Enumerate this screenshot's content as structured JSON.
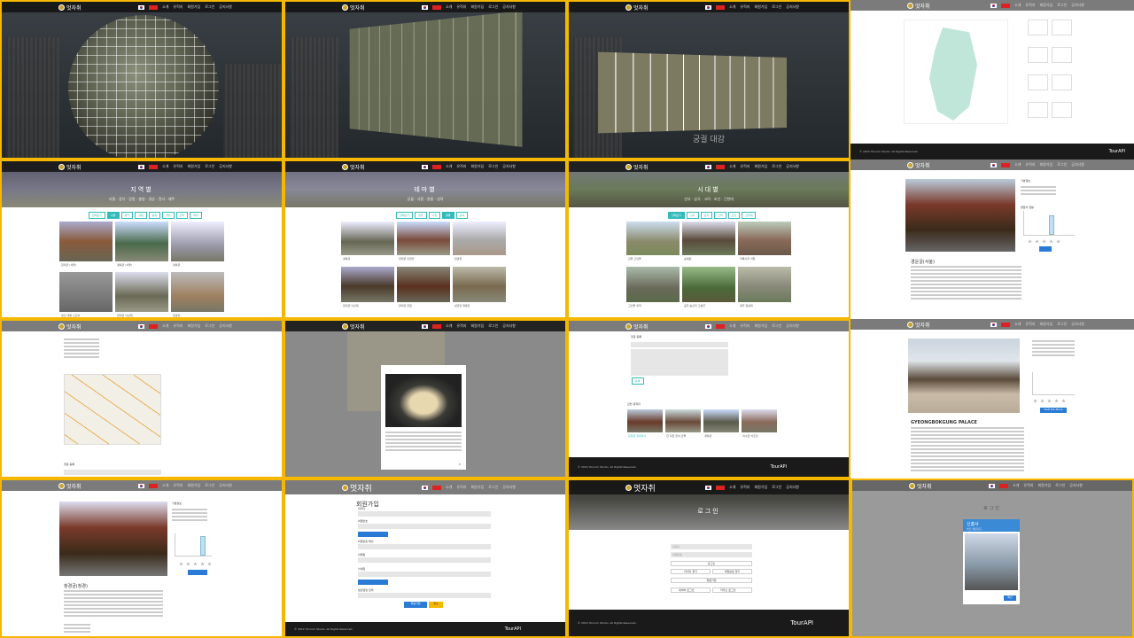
{
  "site": {
    "logo_text": "멋자취",
    "nav_items": [
      "소개",
      "유적지",
      "회원가입",
      "로그인",
      "공지사항"
    ],
    "footer_copy": "© 2019 Ybroom Studio. All Rights Reserved.",
    "footer_brand": "TourAPI",
    "footer_brand_sup": "3.0"
  },
  "panels": {
    "region_title": "지역별",
    "region_sub": "서울 · 경기 · 강원 · 충청 · 경상 · 전라 · 제주",
    "theme_title": "테마별",
    "theme_sub": "궁궐 · 사찰 · 왕릉 · 성곽",
    "era_title": "시대별",
    "era_sub": "선사 · 삼국 · 고려 · 조선 · 근현대",
    "region_tabs": [
      "전체보기",
      "서울",
      "경기",
      "강원",
      "충청",
      "경상",
      "전라",
      "제주"
    ],
    "theme_tabs": [
      "전체보기",
      "궁궐",
      "사찰",
      "왕릉",
      "성곽"
    ],
    "era_tabs": [
      "전체보기",
      "선사",
      "삼국",
      "고려",
      "조선",
      "근현대"
    ],
    "region_captions": [
      "창덕궁 (서울)",
      "경복궁 (서울)",
      "경복궁",
      "영조 대왕 신도비",
      "창덕궁 낙선재",
      "창경궁"
    ],
    "theme_captions": [
      "경복궁",
      "창덕궁 인정전",
      "창경궁",
      "창덕궁 낙선재",
      "창덕궁 후원",
      "성균관 명륜당"
    ],
    "era_captions": [
      "강화 고인돌",
      "숭례문",
      "미륵사지 석탑",
      "고인돌 유적",
      "공주 송산리 고분군",
      "경주 첨성대"
    ],
    "gallery_caption": "궁궐 대감",
    "detail_title": "경운궁(서울)",
    "detail_title2": "창경궁(창경)",
    "detail_en": "GYEONGBOKGUNG PALACE",
    "detail_side": "기본정보",
    "chart_label": "방문자 현황",
    "comment_title": "댓글 등록",
    "comment_btn": "등록",
    "related_title": "관련 유적지",
    "related_captions": [
      "창덕궁 궐내각사",
      "한 다른 궁의 건물",
      "경복궁",
      "덕수궁 석조전"
    ],
    "signup_title": "회원가입",
    "signup_fields": [
      "아이디",
      "비밀번호",
      "비밀번호 확인",
      "이메일",
      "닉네임",
      "생년월일 입력"
    ],
    "signup_btn": "회원가입",
    "cancel_btn": "취소",
    "login_title": "로그인",
    "login_btn": "로그인",
    "login_id_ph": "아이디",
    "login_pw_ph": "비밀번호",
    "find_id": "아이디 찾기",
    "find_pw": "비밀번호 찾기",
    "join": "회원가입",
    "naver_login": "네이버 로그인",
    "kakao_login": "카카오 로그인",
    "popup_title": "신흥사",
    "popup_sub": "부산 해운대구",
    "ok_btn": "확인",
    "english_btn": "Visit the Place"
  },
  "colors": {
    "accent": "#3bbbb5",
    "gold": "#f5b700",
    "primary": "#2a7bd6"
  }
}
